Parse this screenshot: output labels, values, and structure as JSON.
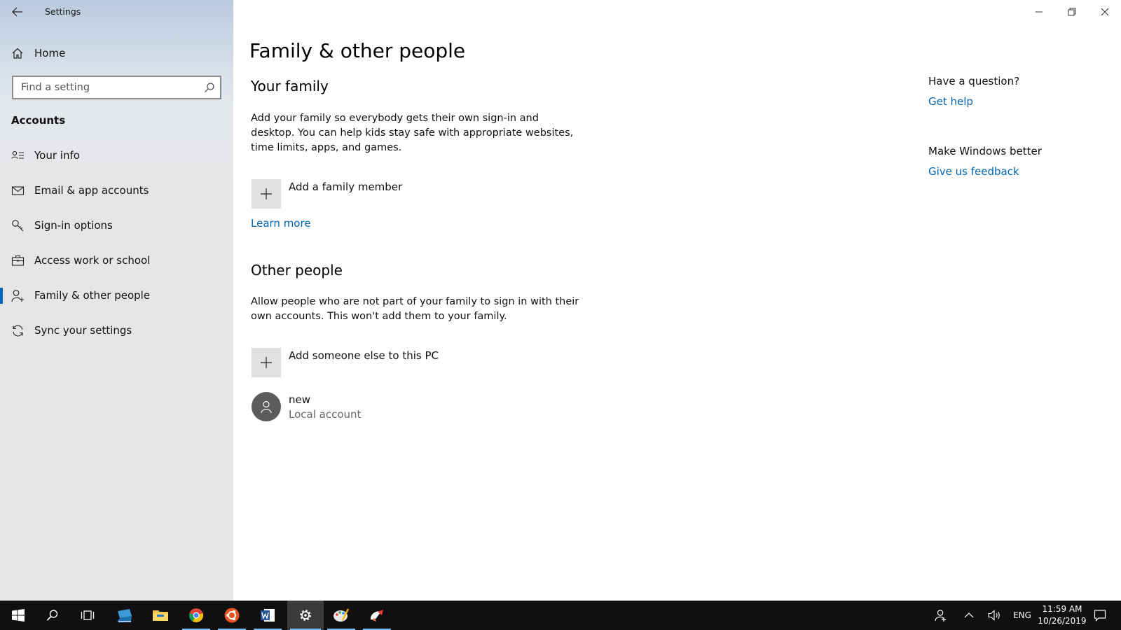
{
  "window": {
    "title": "Settings"
  },
  "sidebar": {
    "home_label": "Home",
    "search_placeholder": "Find a setting",
    "section_label": "Accounts",
    "items": [
      {
        "label": "Your info",
        "icon": "person-card-icon"
      },
      {
        "label": "Email & app accounts",
        "icon": "mail-icon"
      },
      {
        "label": "Sign-in options",
        "icon": "key-icon"
      },
      {
        "label": "Access work or school",
        "icon": "briefcase-icon"
      },
      {
        "label": "Family & other people",
        "icon": "person-add-icon",
        "active": true
      },
      {
        "label": "Sync your settings",
        "icon": "sync-icon"
      }
    ]
  },
  "main": {
    "page_title": "Family & other people",
    "family": {
      "heading": "Your family",
      "description": "Add your family so everybody gets their own sign-in and desktop. You can help kids stay safe with appropriate websites, time limits, apps, and games.",
      "add_label": "Add a family member",
      "learn_more": "Learn more"
    },
    "other": {
      "heading": "Other people",
      "description": "Allow people who are not part of your family to sign in with their own accounts. This won't add them to your family.",
      "add_label": "Add someone else to this PC",
      "accounts": [
        {
          "name": "new",
          "type": "Local account"
        }
      ]
    }
  },
  "help": {
    "question_heading": "Have a question?",
    "get_help": "Get help",
    "feedback_heading": "Make Windows better",
    "give_feedback": "Give us feedback"
  },
  "taskbar": {
    "language": "ENG",
    "time": "11:59 AM",
    "date": "10/26/2019"
  },
  "colors": {
    "accent": "#0067c0",
    "link": "#0063b1",
    "taskbar": "#101010"
  }
}
